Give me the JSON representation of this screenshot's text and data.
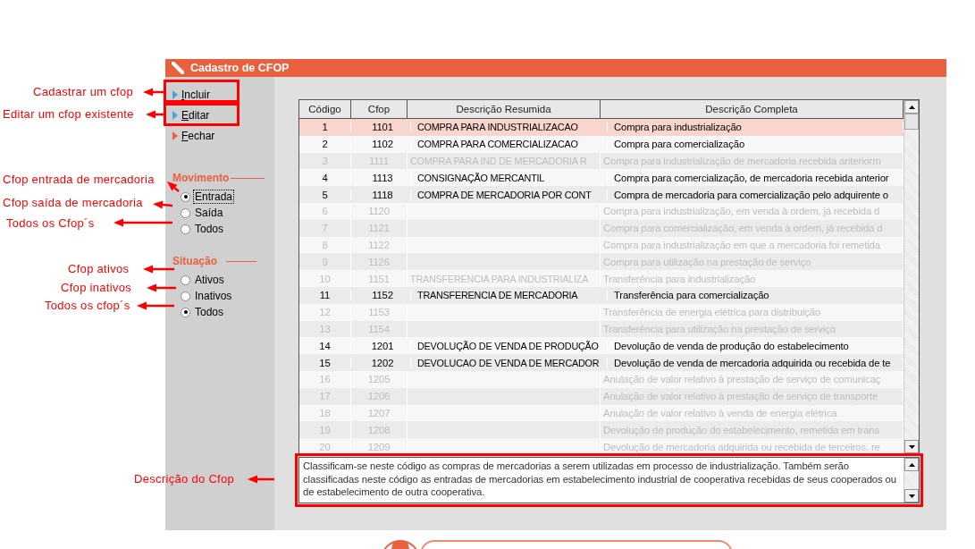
{
  "window": {
    "title": "Cadastro de CFOP"
  },
  "sidebar": {
    "actions": [
      {
        "label": "Incluir",
        "color": "#4aa3d8"
      },
      {
        "label": "Editar",
        "color": "#4aa3d8"
      },
      {
        "label": "Fechar",
        "color": "#e8603f"
      }
    ],
    "movimento": {
      "title": "Movimento",
      "options": [
        {
          "label": "Entrada",
          "selected": true,
          "focused": true
        },
        {
          "label": "Saída",
          "selected": false,
          "focused": false
        },
        {
          "label": "Todos",
          "selected": false,
          "focused": false
        }
      ]
    },
    "situacao": {
      "title": "Situação",
      "options": [
        {
          "label": "Ativos",
          "selected": false
        },
        {
          "label": "Inativos",
          "selected": false
        },
        {
          "label": "Todos",
          "selected": true
        }
      ]
    }
  },
  "table": {
    "columns": [
      "Código",
      "Cfop",
      "Descrição Resumida",
      "Descrição Completa"
    ],
    "rows": [
      {
        "codigo": "1",
        "cfop": "1101",
        "resumida": "COMPRA PARA INDUSTRIALIZACAO",
        "completa": "Compra para industrialização",
        "active": true,
        "selected": true
      },
      {
        "codigo": "2",
        "cfop": "1102",
        "resumida": "COMPRA PARA COMERCIALIZACAO",
        "completa": "Compra para comercialização",
        "active": true,
        "selected": false
      },
      {
        "codigo": "3",
        "cfop": "1111",
        "resumida": "COMPRA PARA IND DE MERCADORIA R",
        "completa": "Compra para industrialização de mercadoria recebida anteriorm",
        "active": false,
        "selected": false
      },
      {
        "codigo": "4",
        "cfop": "1113",
        "resumida": "CONSIGNAÇÃO MERCANTIL",
        "completa": "Compra para comercialização, de mercadoria recebida anterior",
        "active": true,
        "selected": false
      },
      {
        "codigo": "5",
        "cfop": "1118",
        "resumida": "COMPRA DE MERCADORIA POR CONT",
        "completa": "Compra de mercadoria para comercialização pelo adquirente o",
        "active": true,
        "selected": false
      },
      {
        "codigo": "6",
        "cfop": "1120",
        "completa": "Compra para industrialização, em venda à ordem, já recebida d",
        "active": false,
        "selected": false
      },
      {
        "codigo": "7",
        "cfop": "1121",
        "completa": "Compra para comercialização, em venda à ordem, já recebida d",
        "active": false,
        "selected": false
      },
      {
        "codigo": "8",
        "cfop": "1122",
        "completa": "Compra para industrialização em que a mercadoria foi remetida",
        "active": false,
        "selected": false
      },
      {
        "codigo": "9",
        "cfop": "1126",
        "completa": "Compra para utilização na prestação de serviço",
        "active": false,
        "selected": false
      },
      {
        "codigo": "10",
        "cfop": "1151",
        "resumida": "TRANSFERENCIA PARA INDUSTRIALIZA",
        "completa": "Transferência para industrialização",
        "active": false,
        "selected": false
      },
      {
        "codigo": "11",
        "cfop": "1152",
        "resumida": "TRANSFERENCIA DE MERCADORIA",
        "completa": "Transferência para comercialização",
        "active": true,
        "selected": false
      },
      {
        "codigo": "12",
        "cfop": "1153",
        "completa": "Transferência de energia elétrica para distribuição",
        "active": false,
        "selected": false
      },
      {
        "codigo": "13",
        "cfop": "1154",
        "completa": "Transferência para utilização na prestação de serviço",
        "active": false,
        "selected": false
      },
      {
        "codigo": "14",
        "cfop": "1201",
        "resumida": "DEVOLUÇÃO DE VENDA DE PRODUÇÃO",
        "completa": "Devolução de venda de produção do estabelecimento",
        "active": true,
        "selected": false
      },
      {
        "codigo": "15",
        "cfop": "1202",
        "resumida": "DEVOLUCAO DE VENDA DE MERCADOR",
        "completa": "Devolução de venda de mercadoria adquirida ou recebida de te",
        "active": true,
        "selected": false
      },
      {
        "codigo": "16",
        "cfop": "1205",
        "completa": "Anulação de valor relativo à prestação de serviço de comunicaç",
        "active": false,
        "selected": false
      },
      {
        "codigo": "17",
        "cfop": "1206",
        "completa": "Anulação de valor relativo à prestação de serviço de transporte",
        "active": false,
        "selected": false
      },
      {
        "codigo": "18",
        "cfop": "1207",
        "completa": "Anulação de valor relativo à venda de energia elétrica",
        "active": false,
        "selected": false
      },
      {
        "codigo": "19",
        "cfop": "1208",
        "completa": "Devolução de produção do estabelecimento, remetida em trans",
        "active": false,
        "selected": false
      },
      {
        "codigo": "20",
        "cfop": "1209",
        "completa": "Devolução de mercadoria adquirida ou recebida de terceiros, re",
        "active": false,
        "selected": false
      }
    ]
  },
  "description": {
    "text": "Classificam-se neste código as compras de mercadorias a serem utilizadas em processo de industrialização. Também serão classificadas neste código as entradas de mercadorias em estabelecimento industrial de cooperativa recebidas de seus cooperados ou de estabelecimento de outra cooperativa."
  },
  "annotations": [
    "Cadastrar um cfop",
    "Editar um cfop existente",
    "Cfop entrada de mercadoria",
    "Cfop saída de mercadoria",
    "Todos os Cfop´s",
    "Cfop ativos",
    "Cfop inativos",
    "Todos os cfop´s",
    "Descrição do Cfop"
  ]
}
